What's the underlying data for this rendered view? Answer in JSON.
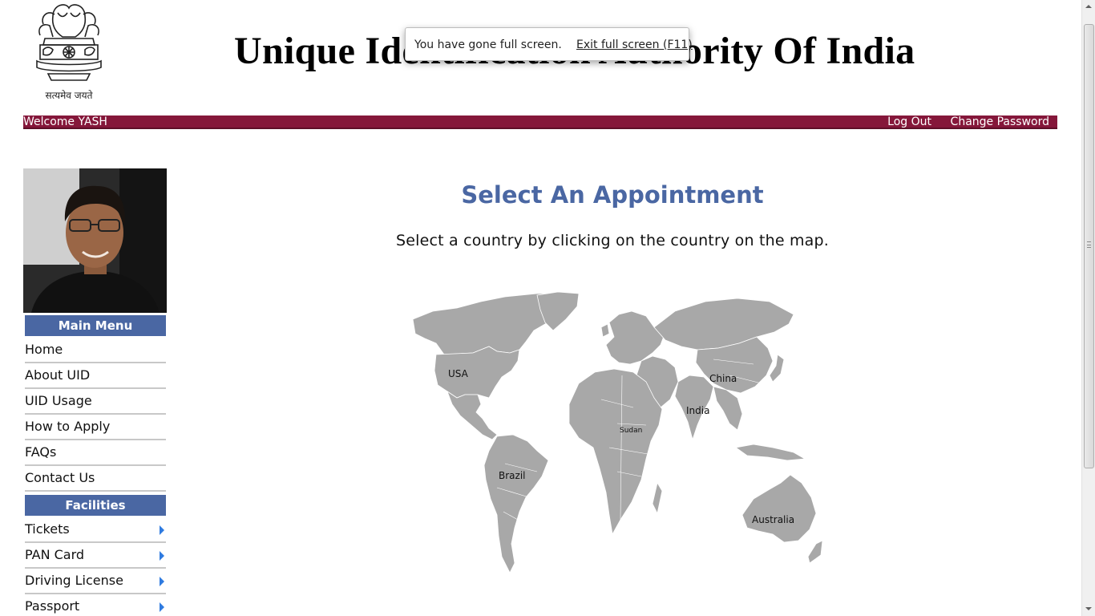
{
  "header": {
    "emblem_motto": "सत्यमेव जयते",
    "title": "Unique Identification Authority Of India"
  },
  "fullscreen_notice": {
    "message": "You have gone full screen.",
    "exit_label": "Exit full screen (F11)"
  },
  "top_bar": {
    "welcome": "Welcome YASH",
    "logout": "Log Out",
    "change_password": "Change Password",
    "color": "#85173a"
  },
  "sidebar": {
    "main_menu_title": "Main Menu",
    "main_menu": [
      {
        "label": "Home"
      },
      {
        "label": "About UID"
      },
      {
        "label": "UID Usage"
      },
      {
        "label": "How to Apply"
      },
      {
        "label": "FAQs"
      },
      {
        "label": "Contact Us"
      }
    ],
    "facilities_title": "Facilities",
    "facilities": [
      {
        "label": "Tickets"
      },
      {
        "label": "PAN Card"
      },
      {
        "label": "Driving License"
      },
      {
        "label": "Passport"
      }
    ],
    "header_color": "#4a67a3"
  },
  "main": {
    "heading": "Select An Appointment",
    "instruction": "Select a country by clicking on the country on the map.",
    "heading_color": "#4a67a3",
    "map": {
      "land_color": "#a8a8a8",
      "countries": [
        {
          "label": "USA"
        },
        {
          "label": "China"
        },
        {
          "label": "India"
        },
        {
          "label": "Sudan"
        },
        {
          "label": "Brazil"
        },
        {
          "label": "Australia"
        }
      ]
    }
  }
}
